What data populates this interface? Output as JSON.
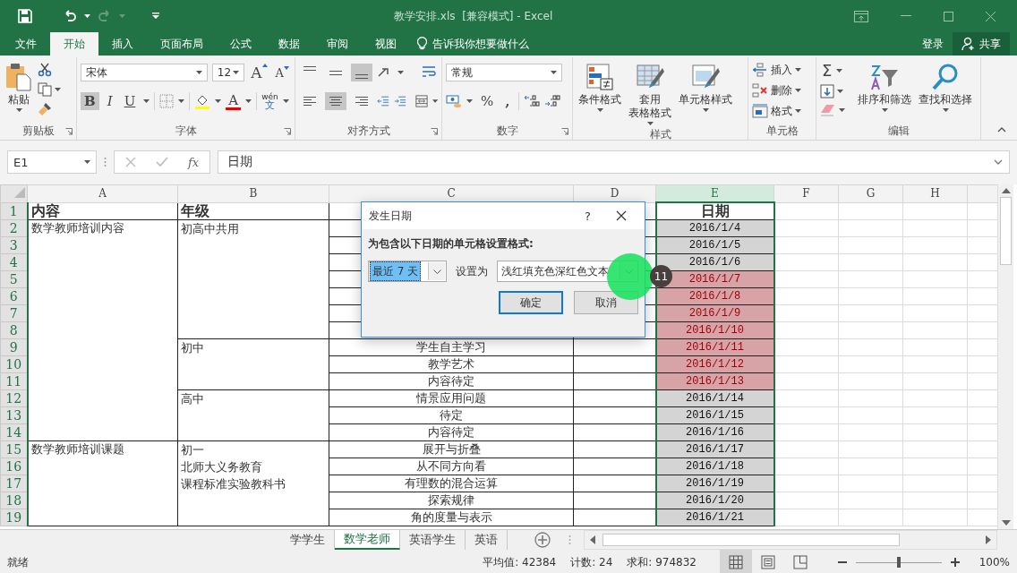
{
  "window": {
    "title": "教学安排.xls  [兼容模式] - Excel",
    "redo": {
      "disabled": true
    }
  },
  "menu_tabs": [
    {
      "label": "文件",
      "selected": false
    },
    {
      "label": "开始",
      "selected": true
    },
    {
      "label": "插入",
      "selected": false
    },
    {
      "label": "页面布局",
      "selected": false
    },
    {
      "label": "公式",
      "selected": false
    },
    {
      "label": "数据",
      "selected": false
    },
    {
      "label": "审阅",
      "selected": false
    },
    {
      "label": "视图",
      "selected": false
    }
  ],
  "tell_me": "告诉我你想要做什么",
  "sign_in": "登录",
  "share": "共享",
  "ribbon": {
    "clipboard": {
      "paste": "粘贴",
      "label": "剪贴板"
    },
    "font": {
      "name": "宋体",
      "size": "12",
      "grow": "A",
      "shrink": "A",
      "font_color": "A",
      "phonetic": [
        "wén",
        "文"
      ],
      "label": "字体",
      "styles": [
        {
          "label": "B",
          "selected": true
        },
        {
          "label": "I",
          "selected": false
        },
        {
          "label": "U",
          "selected": false
        }
      ]
    },
    "alignment": {
      "label": "对齐方式",
      "vertical": [
        {
          "kind": "top",
          "selected": false
        },
        {
          "kind": "middle",
          "selected": false
        },
        {
          "kind": "bottom",
          "selected": true
        }
      ],
      "horizontal": [
        {
          "kind": "left",
          "selected": false
        },
        {
          "kind": "center",
          "selected": true
        },
        {
          "kind": "right",
          "selected": false
        }
      ]
    },
    "number": {
      "format": "常规",
      "percent": "%",
      "comma": ",",
      "label": "数字"
    },
    "styles": {
      "label": "样式",
      "buttons": [
        {
          "kind": "conditional",
          "lines": [
            "条件格式"
          ]
        },
        {
          "kind": "table",
          "lines": [
            "套用",
            "表格格式"
          ]
        },
        {
          "kind": "cell",
          "lines": [
            "单元格样式"
          ]
        }
      ]
    },
    "cells": {
      "label": "单元格",
      "buttons": [
        {
          "kind": "insert",
          "label": "插入"
        },
        {
          "kind": "delete",
          "label": "删除"
        },
        {
          "kind": "format",
          "label": "格式"
        }
      ]
    },
    "editing": {
      "label": "编辑",
      "sum": "Σ",
      "buttons": [
        {
          "kind": "sort",
          "label": "排序和筛选"
        },
        {
          "kind": "find",
          "label": "查找和选择"
        }
      ]
    }
  },
  "formula_bar": {
    "name_box": "E1",
    "fx": "fx",
    "value": "日期"
  },
  "sheet": {
    "columns": [
      {
        "label": "A",
        "selected": false
      },
      {
        "label": "B",
        "selected": false
      },
      {
        "label": "C",
        "selected": false
      },
      {
        "label": "D",
        "selected": false
      },
      {
        "label": "E",
        "selected": true
      },
      {
        "label": "F",
        "selected": false
      },
      {
        "label": "G",
        "selected": false
      },
      {
        "label": "H",
        "selected": false
      }
    ],
    "row_numbers": [
      "1",
      "2",
      "3",
      "4",
      "5",
      "6",
      "7",
      "8",
      "9",
      "10",
      "11",
      "12",
      "13",
      "14",
      "15",
      "16",
      "17",
      "18",
      "19"
    ],
    "header": {
      "content": "内容",
      "grade": "年级",
      "date": "日期"
    },
    "groups": [
      {
        "content": "数学教师培训内容",
        "grades": [
          {
            "lines": [
              "初高中共用"
            ],
            "items": [
              {
                "date": "2016/1/4",
                "highlighted": false
              },
              {
                "date": "2016/1/5",
                "highlighted": false
              },
              {
                "date": "2016/1/6",
                "highlighted": false
              },
              {
                "date": "2016/1/7",
                "highlighted": true
              },
              {
                "date": "2016/1/8",
                "highlighted": true
              },
              {
                "date": "2016/1/9",
                "highlighted": true
              },
              {
                "date": "2016/1/10",
                "highlighted": true
              }
            ]
          },
          {
            "lines": [
              "初中"
            ],
            "items": [
              {
                "topic": "学生自主学习",
                "date": "2016/1/11",
                "highlighted": true
              },
              {
                "topic": "教学艺术",
                "date": "2016/1/12",
                "highlighted": true
              },
              {
                "topic": "内容待定",
                "date": "2016/1/13",
                "highlighted": true
              }
            ]
          },
          {
            "lines": [
              "高中"
            ],
            "items": [
              {
                "topic": "情景应用问题",
                "date": "2016/1/14",
                "highlighted": false
              },
              {
                "topic": "待定",
                "date": "2016/1/15",
                "highlighted": false
              },
              {
                "topic": "内容待定",
                "date": "2016/1/16",
                "highlighted": false
              }
            ]
          }
        ]
      },
      {
        "content": "数学教师培训课题",
        "grades": [
          {
            "lines": [
              "初一",
              "北师大义务教育",
              "课程标准实验教科书"
            ],
            "items": [
              {
                "topic": "展开与折叠",
                "date": "2016/1/17",
                "highlighted": false
              },
              {
                "topic": "从不同方向看",
                "date": "2016/1/18",
                "highlighted": false
              },
              {
                "topic": "有理数的混合运算",
                "date": "2016/1/19",
                "highlighted": false
              },
              {
                "topic": "探索规律",
                "date": "2016/1/20",
                "highlighted": false
              },
              {
                "topic": "角的度量与表示",
                "date": "2016/1/21",
                "highlighted": false
              }
            ]
          }
        ]
      }
    ]
  },
  "dialog": {
    "title": "发生日期",
    "help": "?",
    "prompt": "为包含以下日期的单元格设置格式:",
    "period": "最近 7 天",
    "set_as": "设置为",
    "format": "浅红填充色深红色文本",
    "ok": "确定",
    "cancel": "取消"
  },
  "step_marker": "11",
  "sheet_tabs": [
    {
      "label": "学学生",
      "selected": false
    },
    {
      "label": "数学老师",
      "selected": true
    },
    {
      "label": "英语学生",
      "selected": false
    },
    {
      "label": "英语",
      "selected": false
    }
  ],
  "status_bar": {
    "ready": "就绪",
    "stats": [
      "平均值: 42384",
      "计数: 24",
      "求和: 974832"
    ],
    "views": [
      {
        "kind": "normal",
        "selected": true
      },
      {
        "kind": "page_layout",
        "selected": false
      },
      {
        "kind": "page_break",
        "selected": false
      }
    ],
    "zoom": {
      "level": 0.5,
      "text": "100%"
    }
  }
}
